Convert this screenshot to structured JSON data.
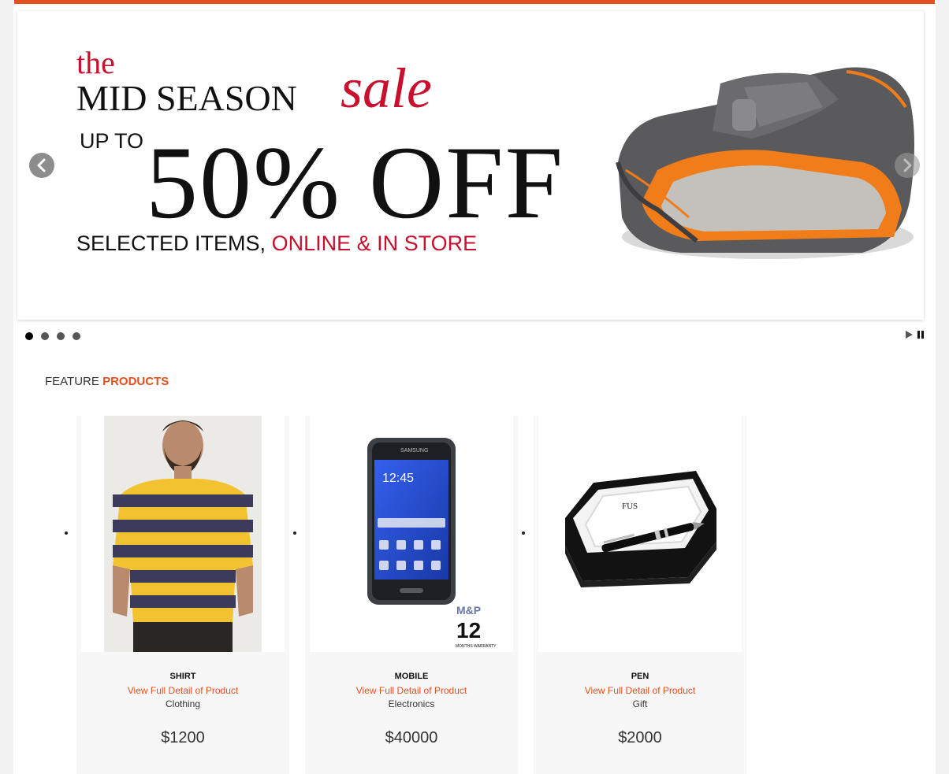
{
  "colors": {
    "accent": "#e4501f",
    "sale_red": "#c8102e"
  },
  "slider": {
    "banner": {
      "the": "the",
      "mid_season": "MID SEASON",
      "sale": "sale",
      "up_to": "UP TO",
      "discount": "50% OFF",
      "selected_items": "SELECTED ITEMS, ",
      "online_store": "ONLINE & IN STORE"
    },
    "prev_label": "Prev",
    "next_label": "Next",
    "slide_count": 4,
    "active_slide": 1
  },
  "feature": {
    "title_plain": "FEATURE",
    "title_accent": "PRODUCTS"
  },
  "products": [
    {
      "name": "SHIRT",
      "link": "View Full Detail of Product",
      "category": "Clothing",
      "price": "$1200",
      "image_icon": "striped-tshirt-image"
    },
    {
      "name": "MOBILE",
      "link": "View Full Detail of Product",
      "category": "Electronics",
      "price": "$40000",
      "image_icon": "smartphone-image"
    },
    {
      "name": "PEN",
      "link": "View Full Detail of Product",
      "category": "Gift",
      "price": "$2000",
      "image_icon": "pen-gift-box-image"
    }
  ]
}
